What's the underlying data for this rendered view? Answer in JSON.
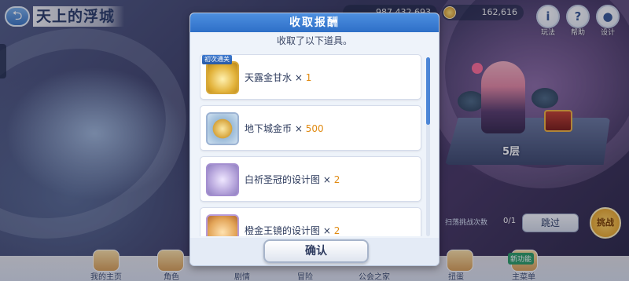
{
  "header": {
    "back_icon": "back-arrow-icon",
    "title": "天上的浮城"
  },
  "currency": {
    "gems": "987,432,693",
    "coins": "162,616"
  },
  "top_buttons": [
    {
      "icon": "info-icon",
      "glyph": "i",
      "label": "玩法"
    },
    {
      "icon": "help-icon",
      "glyph": "?",
      "label": "帮助"
    },
    {
      "icon": "character-icon",
      "glyph": "●",
      "label": "设计"
    }
  ],
  "scene": {
    "floor": "5层",
    "chance_label": "扫荡挑战次数",
    "count": "0/1",
    "skip_button": "跳过",
    "challenge_button": "挑战"
  },
  "dialog": {
    "title": "收取报酬",
    "subtitle": "收取了以下道具。",
    "items": [
      {
        "tag": "初次通关",
        "name": "天露金甘水",
        "sep": " × ",
        "qty": "1",
        "icon": "golden-nectar-icon"
      },
      {
        "name": "地下城金币",
        "sep": " × ",
        "qty": "500",
        "icon": "dungeon-coin-icon"
      },
      {
        "name": "白祈圣冠的设计图",
        "sep": " × ",
        "qty": "2",
        "icon": "crown-blueprint-icon"
      },
      {
        "name": "橙金王镜的设计图",
        "sep": " × ",
        "qty": "2",
        "icon": "blueprint-icon"
      }
    ],
    "confirm": "确认"
  },
  "bottom_nav": [
    {
      "label": "我的主页"
    },
    {
      "label": "角色"
    },
    {
      "label": "剧情"
    },
    {
      "label": "冒险"
    },
    {
      "label": "公会之家"
    },
    {
      "label": "扭蛋"
    },
    {
      "label": "主菜单"
    }
  ],
  "badges": {
    "new": "新功能"
  },
  "colors": {
    "dialog_header": "#2e6fc7",
    "quantity": "#e08a11",
    "scroll_thumb": "#4c86d6"
  }
}
